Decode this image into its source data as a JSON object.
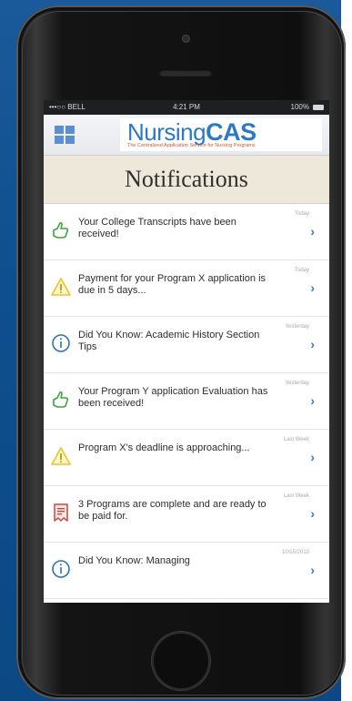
{
  "status_bar": {
    "carrier": "•••○○ BELL",
    "time": "4:21 PM",
    "battery": "100%"
  },
  "app": {
    "brand_prefix": "Nursing",
    "brand_suffix": "CAS",
    "brand_tagline": "The Centralized Application Service for Nursing Programs",
    "page_title": "Notifications"
  },
  "colors": {
    "brand_blue": "#2e78c4",
    "chevron_blue": "#3a78c0",
    "success_green": "#3ea53b",
    "warning_yellow": "#e7c42b",
    "info_blue": "#2f6fb8",
    "payment_red": "#c9483c"
  },
  "notifications": [
    {
      "icon": "thumbs-up-icon",
      "text": "Your College Transcripts have been received!",
      "time": "Today"
    },
    {
      "icon": "warning-icon",
      "text": "Payment for your Program X application is due in 5 days...",
      "time": "Today"
    },
    {
      "icon": "info-icon",
      "text": "Did You Know: Academic History Section Tips",
      "time": "Yesterday"
    },
    {
      "icon": "thumbs-up-icon",
      "text": "Your Program Y application Evaluation has been received!",
      "time": "Yesterday"
    },
    {
      "icon": "warning-icon",
      "text": "Program X's deadline is approaching...",
      "time": "Last Week"
    },
    {
      "icon": "receipt-icon",
      "text": "3 Programs are complete and are ready to be paid for.",
      "time": "Last Week"
    },
    {
      "icon": "info-icon",
      "text": "Did You Know: Managing",
      "time": "10/15/2013"
    }
  ]
}
